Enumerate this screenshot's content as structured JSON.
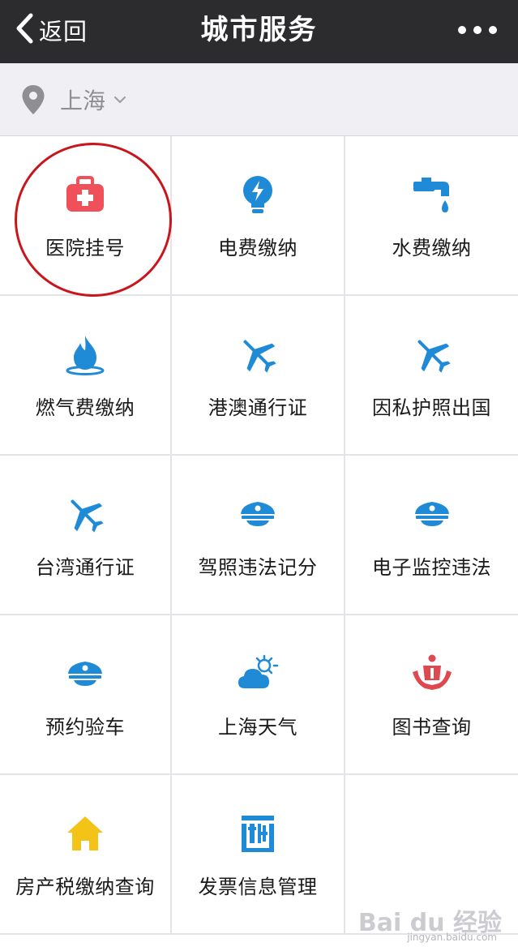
{
  "nav": {
    "back_label": "返回",
    "title": "城市服务"
  },
  "location": {
    "city": "上海"
  },
  "services": [
    {
      "label": "医院挂号",
      "icon": "medical-kit-icon",
      "color": "#f0505a"
    },
    {
      "label": "电费缴纳",
      "icon": "lightbulb-icon",
      "color": "#1f8ad6"
    },
    {
      "label": "水费缴纳",
      "icon": "water-tap-icon",
      "color": "#1f8ad6"
    },
    {
      "label": "燃气费缴纳",
      "icon": "gas-flame-icon",
      "color": "#1f8ad6"
    },
    {
      "label": "港澳通行证",
      "icon": "airplane-icon",
      "color": "#1f8ad6"
    },
    {
      "label": "因私护照出国",
      "icon": "airplane-icon",
      "color": "#1f8ad6"
    },
    {
      "label": "台湾通行证",
      "icon": "airplane-icon",
      "color": "#1f8ad6"
    },
    {
      "label": "驾照违法记分",
      "icon": "police-cap-icon",
      "color": "#1f8ad6"
    },
    {
      "label": "电子监控违法",
      "icon": "police-cap-icon",
      "color": "#1f8ad6"
    },
    {
      "label": "预约验车",
      "icon": "police-cap-icon",
      "color": "#1f8ad6"
    },
    {
      "label": "上海天气",
      "icon": "weather-icon",
      "color": "#1f8ad6"
    },
    {
      "label": "图书查询",
      "icon": "library-icon",
      "color": "#e0484f"
    },
    {
      "label": "房产税缴纳查询",
      "icon": "house-icon",
      "color": "#f3c317"
    },
    {
      "label": "发票信息管理",
      "icon": "tax-icon",
      "color": "#1f8ad6"
    }
  ],
  "watermark": {
    "main": "Bai du 经验",
    "sub": "jingyan.baidu.com"
  },
  "colors": {
    "navbar": "#2c2c2e",
    "highlight": "#c8161d",
    "primary_icon": "#1f8ad6"
  }
}
